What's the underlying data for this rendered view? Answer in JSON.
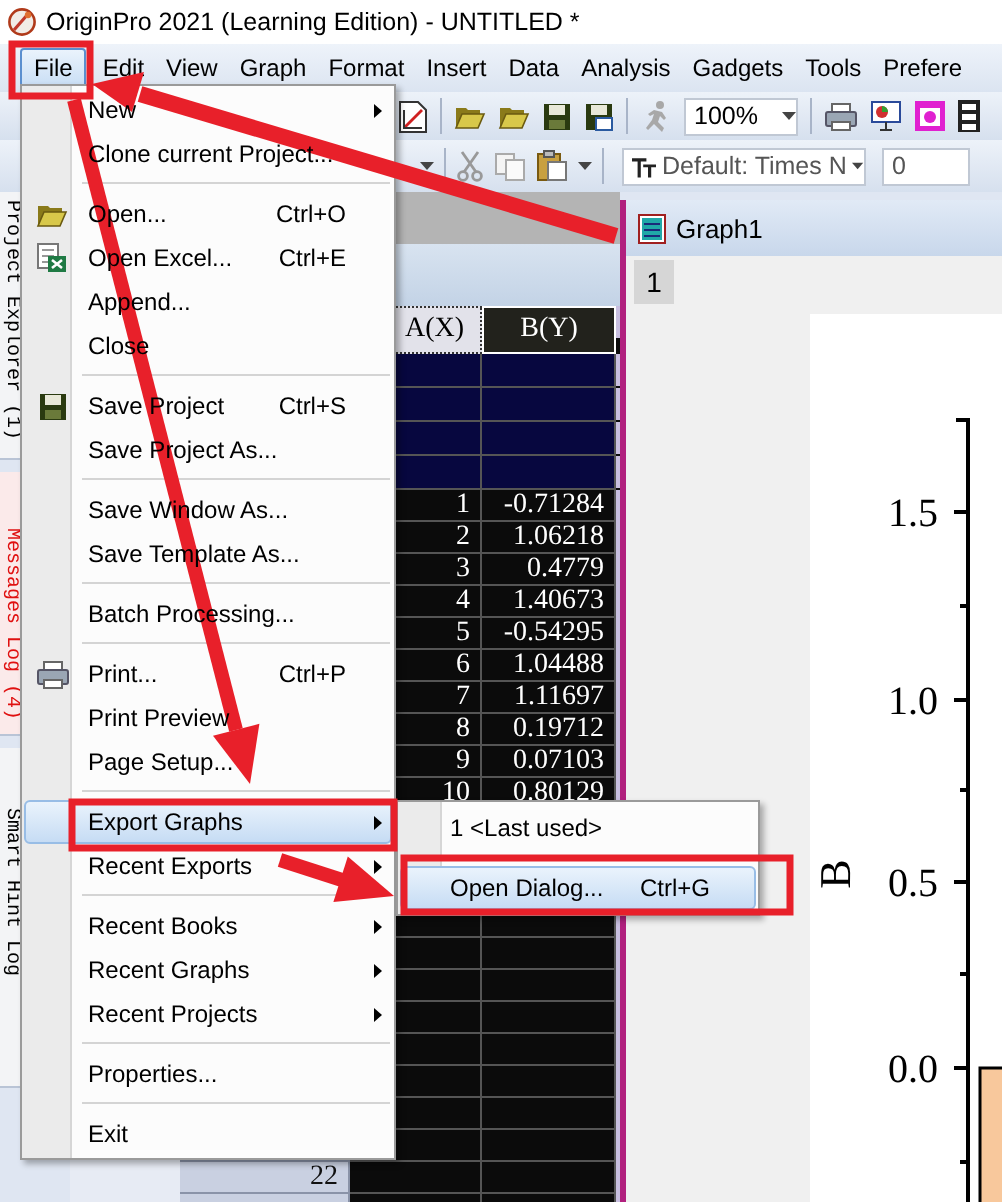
{
  "window": {
    "title": "OriginPro 2021 (Learning Edition) - UNTITLED *"
  },
  "menu_bar": [
    {
      "label": "File",
      "selected": true
    },
    {
      "label": "Edit",
      "selected": false
    },
    {
      "label": "View",
      "selected": false
    },
    {
      "label": "Graph",
      "selected": false
    },
    {
      "label": "Format",
      "selected": false
    },
    {
      "label": "Insert",
      "selected": false
    },
    {
      "label": "Data",
      "selected": false
    },
    {
      "label": "Analysis",
      "selected": false
    },
    {
      "label": "Gadgets",
      "selected": false
    },
    {
      "label": "Tools",
      "selected": false
    },
    {
      "label": "Prefere",
      "selected": false
    }
  ],
  "standard_toolbar": {
    "zoom": "100%"
  },
  "format_toolbar": {
    "font": "Default: Times N",
    "font_size": "0"
  },
  "dock_tabs": [
    {
      "label": "Project Explorer (1)",
      "alert": false
    },
    {
      "label": "Messages Log (4)",
      "alert": true
    },
    {
      "label": "Smart Hint Log",
      "alert": false
    }
  ],
  "file_menu": [
    {
      "kind": "item",
      "label": "New",
      "submenu": true,
      "selected": false
    },
    {
      "kind": "item",
      "label": "Clone current Project...",
      "submenu": false,
      "selected": false
    },
    {
      "kind": "separator"
    },
    {
      "kind": "item",
      "label": "Open...",
      "shortcut": "Ctrl+O",
      "submenu": false,
      "selected": false
    },
    {
      "kind": "item",
      "label": "Open Excel...",
      "shortcut": "Ctrl+E",
      "submenu": false,
      "selected": false
    },
    {
      "kind": "item",
      "label": "Append...",
      "submenu": false,
      "selected": false
    },
    {
      "kind": "item",
      "label": "Close",
      "submenu": false,
      "selected": false
    },
    {
      "kind": "separator"
    },
    {
      "kind": "item",
      "label": "Save Project",
      "shortcut": "Ctrl+S",
      "submenu": false,
      "selected": false
    },
    {
      "kind": "item",
      "label": "Save Project As...",
      "submenu": false,
      "selected": false
    },
    {
      "kind": "separator"
    },
    {
      "kind": "item",
      "label": "Save Window As...",
      "submenu": false,
      "selected": false
    },
    {
      "kind": "item",
      "label": "Save Template As...",
      "submenu": false,
      "selected": false
    },
    {
      "kind": "separator"
    },
    {
      "kind": "item",
      "label": "Batch Processing...",
      "submenu": false,
      "selected": false
    },
    {
      "kind": "separator"
    },
    {
      "kind": "item",
      "label": "Print...",
      "shortcut": "Ctrl+P",
      "submenu": false,
      "selected": false
    },
    {
      "kind": "item",
      "label": "Print Preview",
      "submenu": false,
      "selected": false
    },
    {
      "kind": "item",
      "label": "Page Setup...",
      "submenu": false,
      "selected": false
    },
    {
      "kind": "separator"
    },
    {
      "kind": "item",
      "label": "Export Graphs",
      "submenu": true,
      "selected": true
    },
    {
      "kind": "item",
      "label": "Recent Exports",
      "submenu": true,
      "selected": false
    },
    {
      "kind": "separator"
    },
    {
      "kind": "item",
      "label": "Recent Books",
      "submenu": true,
      "selected": false
    },
    {
      "kind": "item",
      "label": "Recent Graphs",
      "submenu": true,
      "selected": false
    },
    {
      "kind": "item",
      "label": "Recent Projects",
      "submenu": true,
      "selected": false
    },
    {
      "kind": "separator"
    },
    {
      "kind": "item",
      "label": "Properties...",
      "submenu": false,
      "selected": false
    },
    {
      "kind": "separator"
    },
    {
      "kind": "item",
      "label": "Exit",
      "submenu": false,
      "selected": false
    }
  ],
  "export_submenu": [
    {
      "kind": "item",
      "label": "1 <Last used>",
      "selected": false
    },
    {
      "kind": "separator"
    },
    {
      "kind": "item",
      "label": "Open Dialog...",
      "shortcut": "Ctrl+G",
      "selected": true
    }
  ],
  "worksheet": {
    "columns": [
      "A(X)",
      "B(Y)"
    ],
    "rows": [
      {
        "a": "1",
        "b": "-0.71284"
      },
      {
        "a": "2",
        "b": "1.06218"
      },
      {
        "a": "3",
        "b": "0.4779"
      },
      {
        "a": "4",
        "b": "1.40673"
      },
      {
        "a": "5",
        "b": "-0.54295"
      },
      {
        "a": "6",
        "b": "1.04488"
      },
      {
        "a": "7",
        "b": "1.11697"
      },
      {
        "a": "8",
        "b": "0.19712"
      },
      {
        "a": "9",
        "b": "0.07103"
      },
      {
        "a": "10",
        "b": "0.80129"
      }
    ],
    "visible_row_numbers": [
      "22"
    ]
  },
  "graph_window": {
    "title": "Graph1",
    "layer": "1",
    "y_axis": {
      "title": "B",
      "ticks": [
        "1.5",
        "1.0",
        "0.5",
        "0.0"
      ]
    }
  }
}
